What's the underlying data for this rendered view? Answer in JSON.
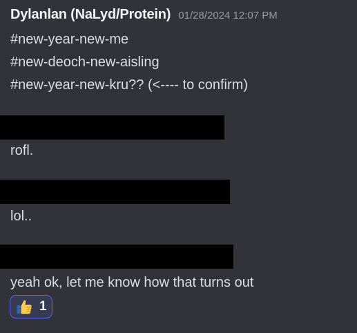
{
  "message": {
    "author": "Dylanlan (NaLyd/Protein)",
    "timestamp": "01/28/2024 12:07 PM",
    "lines": [
      "#new-year-new-me",
      "#new-deoch-new-aisling",
      "#new-year-new-kru?? (<---- to confirm)"
    ]
  },
  "followups": [
    {
      "text": "rofl."
    },
    {
      "text": "lol.."
    },
    {
      "text": "yeah ok, let me know how that turns out"
    }
  ],
  "reaction": {
    "emoji": "thumbs-up-icon",
    "count": "1",
    "accent_color": "#5865f2"
  },
  "colors": {
    "background": "#313338",
    "text": "#dbdee1",
    "timestamp": "#949ba4",
    "redaction": "#000000"
  }
}
